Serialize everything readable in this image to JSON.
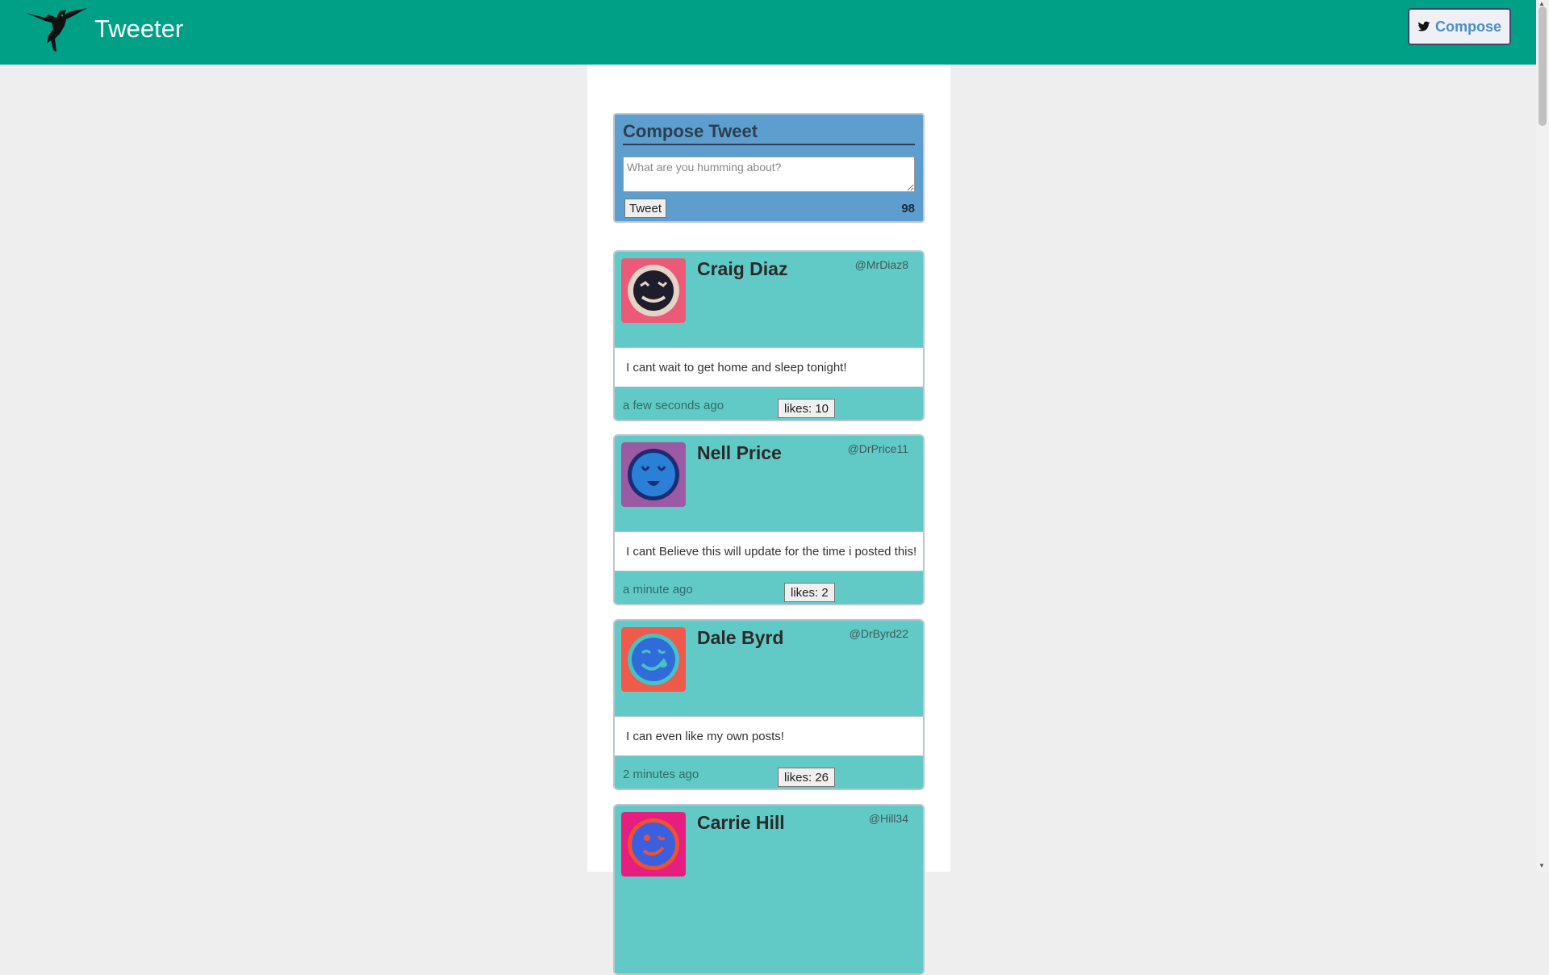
{
  "header": {
    "brand": "Tweeter",
    "compose_label": "Compose",
    "bg_color": "#00a087"
  },
  "compose": {
    "title": "Compose Tweet",
    "placeholder": "What are you humming about?",
    "tweet_label": "Tweet",
    "counter": "98"
  },
  "tweets": [
    {
      "name": "Craig Diaz",
      "handle": "@MrDiaz8",
      "text": "I cant wait to get home and sleep tonight!",
      "time": "a few seconds ago",
      "likes": "likes: 10",
      "avatar_bg": "#ec5a7a",
      "avatar_face": "#1d1d2b",
      "avatar_ring": "#e6d3c8",
      "avatar_icon": "dizzy-face-icon"
    },
    {
      "name": "Nell Price",
      "handle": "@DrPrice11",
      "text": "I cant Believe this will update for the time i posted this!",
      "time": "a minute ago",
      "likes": "likes: 2",
      "avatar_bg": "#9b5aa3",
      "avatar_face": "#2a7fd6",
      "avatar_ring": "#1c2c72",
      "avatar_icon": "relieved-face-icon"
    },
    {
      "name": "Dale Byrd",
      "handle": "@DrByrd22",
      "text": "I can even like my own posts!",
      "time": "2 minutes ago",
      "likes": "likes: 26",
      "avatar_bg": "#f05a4a",
      "avatar_face": "#2f6cd9",
      "avatar_ring": "#46c2c7",
      "avatar_icon": "tongue-face-icon"
    },
    {
      "name": "Carrie Hill",
      "handle": "@Hill34",
      "text": "",
      "time": "",
      "likes": "",
      "avatar_bg": "#e61e7f",
      "avatar_face": "#3c5fe0",
      "avatar_ring": "#f0512f",
      "avatar_icon": "wink-face-icon"
    }
  ]
}
